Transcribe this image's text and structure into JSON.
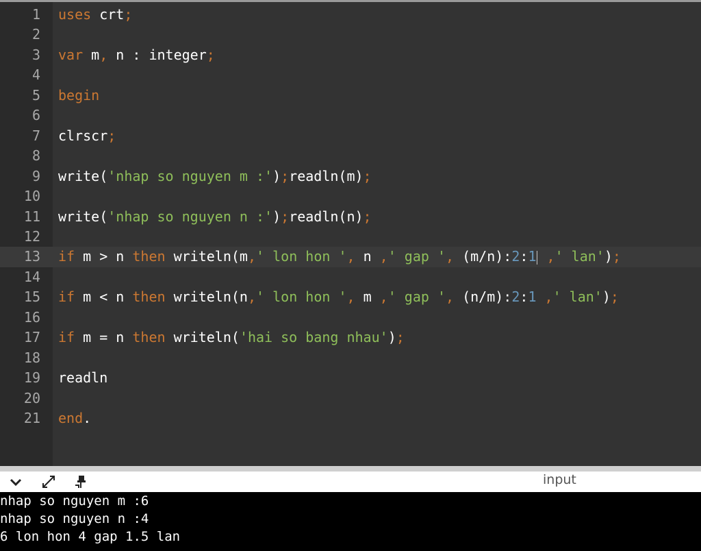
{
  "editor": {
    "active_line": 13,
    "lines": [
      {
        "n": "1",
        "tokens": [
          [
            "kw",
            "uses"
          ],
          [
            "txt",
            " crt"
          ],
          [
            "punct",
            ";"
          ]
        ]
      },
      {
        "n": "2",
        "tokens": []
      },
      {
        "n": "3",
        "tokens": [
          [
            "kw",
            "var"
          ],
          [
            "txt",
            " m"
          ],
          [
            "punct",
            ","
          ],
          [
            "txt",
            " n : integer"
          ],
          [
            "punct",
            ";"
          ]
        ]
      },
      {
        "n": "4",
        "tokens": []
      },
      {
        "n": "5",
        "tokens": [
          [
            "kw",
            "begin"
          ]
        ]
      },
      {
        "n": "6",
        "tokens": []
      },
      {
        "n": "7",
        "tokens": [
          [
            "txt",
            "clrscr"
          ],
          [
            "punct",
            ";"
          ]
        ]
      },
      {
        "n": "8",
        "tokens": []
      },
      {
        "n": "9",
        "tokens": [
          [
            "txt",
            "write("
          ],
          [
            "str",
            "'nhap so nguyen m :'"
          ],
          [
            "txt",
            ")"
          ],
          [
            "punct",
            ";"
          ],
          [
            "txt",
            "readln(m)"
          ],
          [
            "punct",
            ";"
          ]
        ]
      },
      {
        "n": "10",
        "tokens": []
      },
      {
        "n": "11",
        "tokens": [
          [
            "txt",
            "write("
          ],
          [
            "str",
            "'nhap so nguyen n :'"
          ],
          [
            "txt",
            ")"
          ],
          [
            "punct",
            ";"
          ],
          [
            "txt",
            "readln(n)"
          ],
          [
            "punct",
            ";"
          ]
        ]
      },
      {
        "n": "12",
        "tokens": []
      },
      {
        "n": "13",
        "tokens": [
          [
            "kw",
            "if"
          ],
          [
            "txt",
            " m > n "
          ],
          [
            "kw",
            "then"
          ],
          [
            "txt",
            " writeln(m"
          ],
          [
            "punct",
            ","
          ],
          [
            "str",
            "' lon hon '"
          ],
          [
            "punct",
            ","
          ],
          [
            "txt",
            " n "
          ],
          [
            "punct",
            ","
          ],
          [
            "str",
            "' gap '"
          ],
          [
            "punct",
            ","
          ],
          [
            "txt",
            " (m/n):"
          ],
          [
            "num",
            "2"
          ],
          [
            "txt",
            ":"
          ],
          [
            "num",
            "1"
          ],
          [
            "cursor",
            ""
          ],
          [
            "txt",
            " "
          ],
          [
            "punct",
            ","
          ],
          [
            "str",
            "' lan'"
          ],
          [
            "txt",
            ")"
          ],
          [
            "punct",
            ";"
          ]
        ]
      },
      {
        "n": "14",
        "tokens": []
      },
      {
        "n": "15",
        "tokens": [
          [
            "kw",
            "if"
          ],
          [
            "txt",
            " m < n "
          ],
          [
            "kw",
            "then"
          ],
          [
            "txt",
            " writeln(n"
          ],
          [
            "punct",
            ","
          ],
          [
            "str",
            "' lon hon '"
          ],
          [
            "punct",
            ","
          ],
          [
            "txt",
            " m "
          ],
          [
            "punct",
            ","
          ],
          [
            "str",
            "' gap '"
          ],
          [
            "punct",
            ","
          ],
          [
            "txt",
            " (n/m):"
          ],
          [
            "num",
            "2"
          ],
          [
            "txt",
            ":"
          ],
          [
            "num",
            "1"
          ],
          [
            "txt",
            " "
          ],
          [
            "punct",
            ","
          ],
          [
            "str",
            "' lan'"
          ],
          [
            "txt",
            ")"
          ],
          [
            "punct",
            ";"
          ]
        ]
      },
      {
        "n": "16",
        "tokens": []
      },
      {
        "n": "17",
        "tokens": [
          [
            "kw",
            "if"
          ],
          [
            "txt",
            " m = n "
          ],
          [
            "kw",
            "then"
          ],
          [
            "txt",
            " writeln("
          ],
          [
            "str",
            "'hai so bang nhau'"
          ],
          [
            "txt",
            ")"
          ],
          [
            "punct",
            ";"
          ]
        ]
      },
      {
        "n": "18",
        "tokens": []
      },
      {
        "n": "19",
        "tokens": [
          [
            "txt",
            "readln"
          ]
        ]
      },
      {
        "n": "20",
        "tokens": []
      },
      {
        "n": "21",
        "tokens": [
          [
            "kw",
            "end"
          ],
          [
            "txt",
            "."
          ]
        ]
      }
    ]
  },
  "panel": {
    "label": "input",
    "icons": [
      "chevron-down-icon",
      "expand-icon",
      "pin-icon"
    ]
  },
  "console": {
    "lines": [
      "nhap so nguyen m :6",
      "nhap so nguyen n :4",
      "6 lon hon 4 gap 1.5 lan"
    ]
  }
}
